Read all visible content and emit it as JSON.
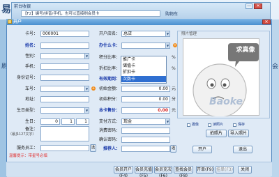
{
  "background": {
    "app_glyph": "易",
    "back_window": {
      "title": "前台收银",
      "search_text": "【F2】编号/拼音/手机，也可以直接刷会员卡",
      "label": "购物车",
      "min_glyph": "—",
      "close_glyph": "✕"
    },
    "left_glyph": "刷",
    "right_glyph": "会"
  },
  "dialog": {
    "title": "开户",
    "close_glyph": "✕"
  },
  "form": {
    "card_no": {
      "label": "卡号：",
      "value": "000001"
    },
    "name": {
      "label": "姓名：",
      "value": ""
    },
    "gender": {
      "label": "性别：",
      "value": ""
    },
    "phone": {
      "label": "手机：",
      "value": ""
    },
    "id_card": {
      "label": "身份证号：",
      "value": ""
    },
    "plate": {
      "label": "车号：",
      "value": ""
    },
    "address": {
      "label": "地址：",
      "value": ""
    },
    "birthday_type": {
      "label": "生日类型：",
      "value": ""
    },
    "birthday": {
      "label": "生日：",
      "year": "0",
      "month": "1",
      "day": "1"
    },
    "note": {
      "label": "备注：",
      "hint": "（最多127文字）",
      "value": ""
    },
    "staff": {
      "label": "服务员工：",
      "value": "",
      "pick": "选"
    },
    "shop": {
      "label": "开户店名：",
      "value": "总店"
    },
    "card_type": {
      "label": "办什么卡：",
      "value": ""
    },
    "points_ratio": {
      "label": "积分比率：",
      "value": "",
      "unit": "%"
    },
    "discount_ratio": {
      "label": "折扣比率：",
      "value": "",
      "unit": "%"
    },
    "valid_until": {
      "label": "有效期到：",
      "value": ""
    },
    "init_amount": {
      "label": "初始金额：",
      "value": "0.00",
      "unit": "元"
    },
    "init_points": {
      "label": "初始积分：",
      "value": "0.00",
      "unit": "分"
    },
    "price": {
      "label": "本卡售价：",
      "value": "0.00",
      "unit": "元"
    },
    "payment": {
      "label": "支付方式：",
      "value": "现金"
    },
    "password": {
      "label": "消费密码：",
      "value": ""
    },
    "confirm": {
      "label": "确认密码：",
      "value": ""
    },
    "recommender": {
      "label": "推荐人：",
      "value": "",
      "pick": "选"
    }
  },
  "card_type_options": [
    "推广卡",
    "储值卡",
    "折扣卡",
    "次数卡"
  ],
  "card_type_highlight": "次数卡",
  "photo": {
    "label": "照片管理",
    "placeholder_text": "求真像",
    "watermark": "Baoke",
    "capture_label": "摄像",
    "read_label": "读照片",
    "save_label": "保存",
    "camera_button": "拍照片",
    "load_button": "导入照片",
    "open_button": "开户",
    "cancel_button": "退出"
  },
  "tip": "温馨提示：带星号必填",
  "bottom_buttons": [
    "会员开户(F4)",
    "会员充值(F5)",
    "会员充次(F6)",
    "查找会员(F8)",
    "开单(F9)",
    "挂单(F3)",
    "关闭"
  ],
  "colors": {
    "titlebar": "#4a8fcf",
    "selection": "#2f6fd1",
    "required_label": "#1636a8",
    "price_value": "#d22020"
  }
}
